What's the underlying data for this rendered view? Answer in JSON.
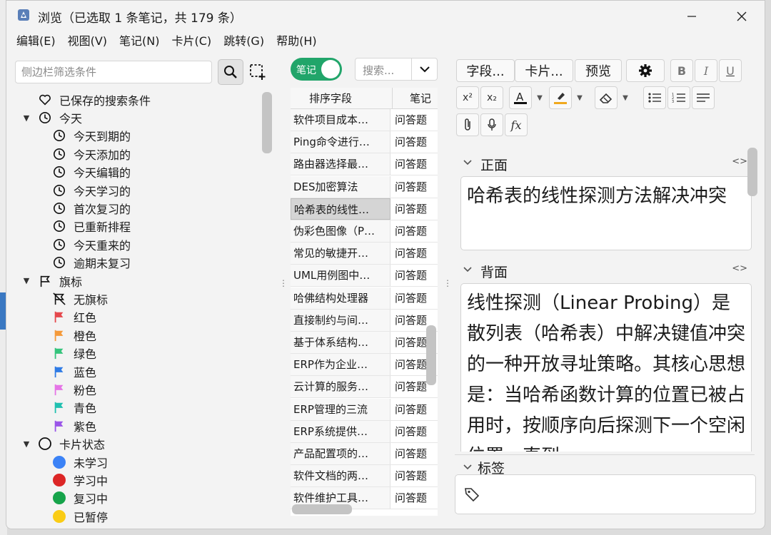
{
  "window": {
    "title": "浏览（已选取 1 条笔记，共 179 条）"
  },
  "menu": [
    "编辑(E)",
    "视图(V)",
    "笔记(N)",
    "卡片(C)",
    "跳转(G)",
    "帮助(H)"
  ],
  "sidebar": {
    "filter_placeholder": "侧边栏筛选条件",
    "tree": [
      {
        "label": "已保存的搜索条件",
        "icon": "heart-icon",
        "level": 0,
        "expander": ""
      },
      {
        "label": "今天",
        "icon": "clock-icon",
        "level": 0,
        "expander": "▼"
      },
      {
        "label": "今天到期的",
        "icon": "clock-icon",
        "level": 1,
        "expander": ""
      },
      {
        "label": "今天添加的",
        "icon": "clock-icon",
        "level": 1,
        "expander": ""
      },
      {
        "label": "今天编辑的",
        "icon": "clock-icon",
        "level": 1,
        "expander": ""
      },
      {
        "label": "今天学习的",
        "icon": "clock-icon",
        "level": 1,
        "expander": ""
      },
      {
        "label": "首次复习的",
        "icon": "clock-icon",
        "level": 1,
        "expander": ""
      },
      {
        "label": "已重新排程",
        "icon": "clock-icon",
        "level": 1,
        "expander": ""
      },
      {
        "label": "今天重来的",
        "icon": "clock-icon",
        "level": 1,
        "expander": ""
      },
      {
        "label": "逾期未复习",
        "icon": "clock-icon",
        "level": 1,
        "expander": ""
      },
      {
        "label": "旗标",
        "icon": "flag-outline-icon",
        "level": 0,
        "expander": "▼"
      },
      {
        "label": "无旗标",
        "icon": "flag-off-icon",
        "level": 1,
        "expander": ""
      },
      {
        "label": "红色",
        "icon": "flag-icon",
        "level": 1,
        "expander": "",
        "color": "#e5484d"
      },
      {
        "label": "橙色",
        "icon": "flag-icon",
        "level": 1,
        "expander": "",
        "color": "#f59a3a"
      },
      {
        "label": "绿色",
        "icon": "flag-icon",
        "level": 1,
        "expander": "",
        "color": "#35c47c"
      },
      {
        "label": "蓝色",
        "icon": "flag-icon",
        "level": 1,
        "expander": "",
        "color": "#2f7be5"
      },
      {
        "label": "粉色",
        "icon": "flag-icon",
        "level": 1,
        "expander": "",
        "color": "#e575e6"
      },
      {
        "label": "青色",
        "icon": "flag-icon",
        "level": 1,
        "expander": "",
        "color": "#20c0b0"
      },
      {
        "label": "紫色",
        "icon": "flag-icon",
        "level": 1,
        "expander": "",
        "color": "#9a55e8"
      },
      {
        "label": "卡片状态",
        "icon": "circle-outline-icon",
        "level": 0,
        "expander": "▼"
      },
      {
        "label": "未学习",
        "icon": "dot-icon",
        "level": 1,
        "expander": "",
        "color": "#3b82f6"
      },
      {
        "label": "学习中",
        "icon": "dot-icon",
        "level": 1,
        "expander": "",
        "color": "#dc2626"
      },
      {
        "label": "复习中",
        "icon": "dot-icon",
        "level": 1,
        "expander": "",
        "color": "#16a34a"
      },
      {
        "label": "已暂停",
        "icon": "dot-icon",
        "level": 1,
        "expander": "",
        "color": "#facc15"
      }
    ]
  },
  "middle": {
    "toggle_label": "笔记",
    "search_placeholder": "搜索...",
    "columns": [
      "排序字段",
      "笔记"
    ],
    "rows": [
      {
        "sort": "软件项目成本…",
        "type": "问答题"
      },
      {
        "sort": "Ping命令进行…",
        "type": "问答题"
      },
      {
        "sort": "路由器选择最…",
        "type": "问答题"
      },
      {
        "sort": "DES加密算法",
        "type": "问答题"
      },
      {
        "sort": "哈希表的线性…",
        "type": "问答题",
        "selected": true
      },
      {
        "sort": "伪彩色图像（P…",
        "type": "问答题"
      },
      {
        "sort": "常见的敏捷开…",
        "type": "问答题"
      },
      {
        "sort": "UML用例图中…",
        "type": "问答题"
      },
      {
        "sort": "哈佛结构处理器",
        "type": "问答题"
      },
      {
        "sort": "直接制约与间…",
        "type": "问答题"
      },
      {
        "sort": "基于体系结构…",
        "type": "问答题"
      },
      {
        "sort": "ERP作为企业…",
        "type": "问答题"
      },
      {
        "sort": "云计算的服务…",
        "type": "问答题"
      },
      {
        "sort": "ERP管理的三流",
        "type": "问答题"
      },
      {
        "sort": "ERP系统提供…",
        "type": "问答题"
      },
      {
        "sort": "产品配置项的…",
        "type": "问答题"
      },
      {
        "sort": "软件文档的两…",
        "type": "问答题"
      },
      {
        "sort": "软件维护工具…",
        "type": "问答题"
      }
    ]
  },
  "editor": {
    "buttons": {
      "fields": "字段...",
      "cards": "卡片...",
      "preview": "预览"
    },
    "front": {
      "name": "正面",
      "content": "哈希表的线性探测方法解决冲突"
    },
    "back": {
      "name": "背面",
      "content": "线性探测（Linear Probing）是散列表（哈希表）中解决键值冲突的一种开放寻址策略。其核心思想是：当哈希函数计算的位置已被占用时，按顺序向后探测下一个空闲位置，直到"
    },
    "tags": {
      "name": "标签"
    }
  }
}
